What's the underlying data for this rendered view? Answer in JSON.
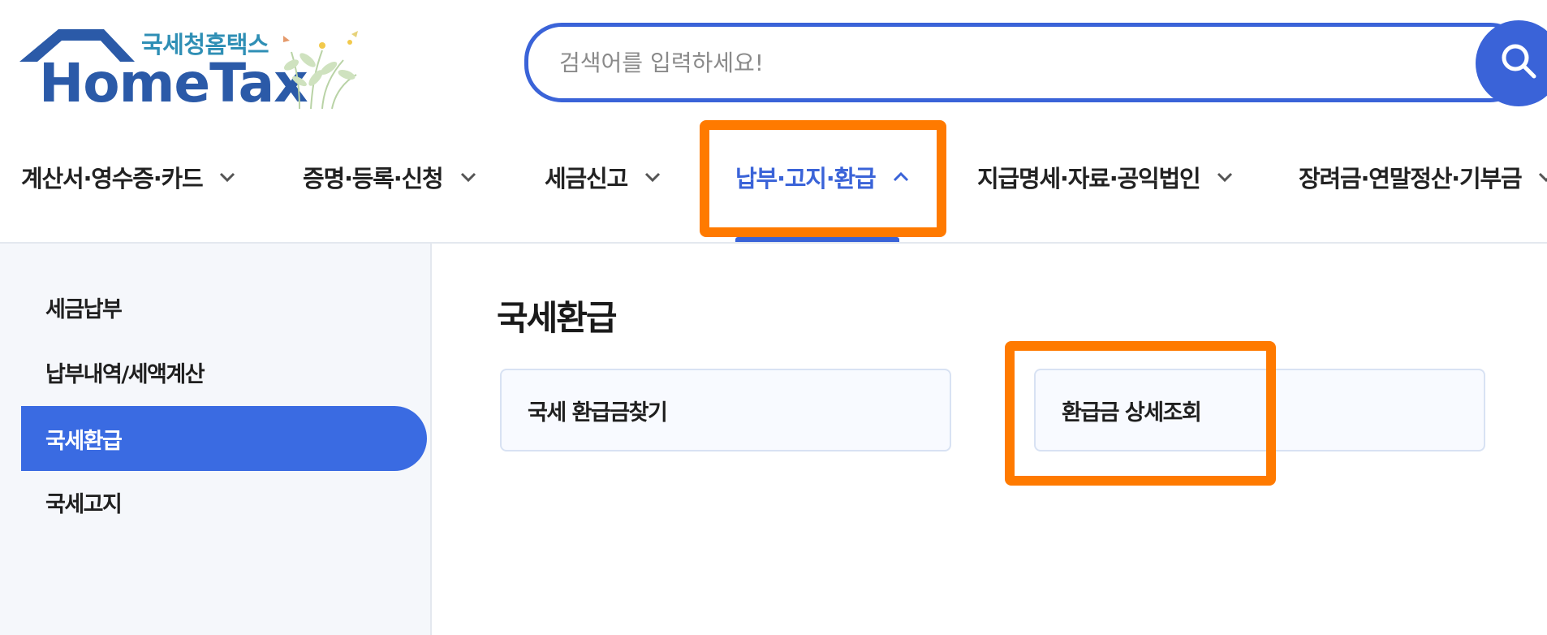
{
  "logo": {
    "tagline": "국세청홈택스",
    "wordmark": "HomeTax"
  },
  "search": {
    "placeholder": "검색어를 입력하세요!",
    "button_icon": "search-icon"
  },
  "gnb": {
    "items": [
      {
        "label": "계산서·영수증·카드",
        "icon": "chevron-down-icon"
      },
      {
        "label": "증명·등록·신청",
        "icon": "chevron-down-icon"
      },
      {
        "label": "세금신고",
        "icon": "chevron-down-icon"
      },
      {
        "label": "납부·고지·환급",
        "icon": "chevron-up-icon",
        "active": true
      },
      {
        "label": "지급명세·자료·공익법인",
        "icon": "chevron-down-icon"
      },
      {
        "label": "장려금·연말정산·기부금",
        "icon": "chevron-down-icon"
      }
    ]
  },
  "lnb": {
    "items": [
      {
        "label": "세금납부"
      },
      {
        "label": "납부내역/세액계산"
      },
      {
        "label": "국세환급",
        "active": true
      },
      {
        "label": "국세고지"
      }
    ]
  },
  "content": {
    "title": "국세환급",
    "cards": [
      {
        "label": "국세 환급금찾기"
      },
      {
        "label": "환급금 상세조회"
      }
    ]
  },
  "colors": {
    "brand_blue": "#3a63d8",
    "highlight_orange": "#ff7a00",
    "lnb_active": "#3a6be2"
  }
}
